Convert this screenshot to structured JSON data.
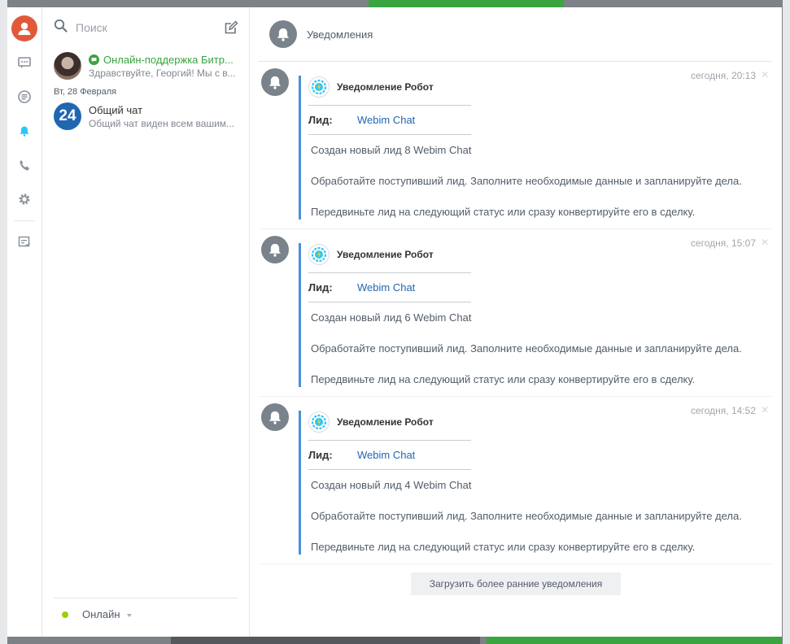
{
  "search": {
    "placeholder": "Поиск"
  },
  "chats": [
    {
      "title": "Онлайн-поддержка Битр...",
      "subtitle": "Здравствуйте, Георгий! Мы с в..."
    }
  ],
  "date_separator": "Вт, 28 Февраля",
  "chats_after_date": [
    {
      "avatar_text": "24",
      "title": "Общий чат",
      "subtitle": "Общий чат виден всем вашим..."
    }
  ],
  "status": {
    "label": "Онлайн"
  },
  "header": {
    "title": "Уведомления"
  },
  "notifications": [
    {
      "date": "сегодня, 20:13",
      "author": "Уведомление Робот",
      "field_label": "Лид:",
      "field_value": "Webim Chat",
      "line1": "Создан новый лид 8 Webim Chat",
      "line2": "Обработайте поступивший лид. Заполните необходимые данные и запланируйте дела.",
      "line3": "Передвиньте лид на следующий статус или сразу конвертируйте его в сделку."
    },
    {
      "date": "сегодня, 15:07",
      "author": "Уведомление Робот",
      "field_label": "Лид:",
      "field_value": "Webim Chat",
      "line1": "Создан новый лид 6 Webim Chat",
      "line2": "Обработайте поступивший лид. Заполните необходимые данные и запланируйте дела.",
      "line3": "Передвиньте лид на следующий статус или сразу конвертируйте его в сделку."
    },
    {
      "date": "сегодня, 14:52",
      "author": "Уведомление Робот",
      "field_label": "Лид:",
      "field_value": "Webim Chat",
      "line1": "Создан новый лид 4 Webim Chat",
      "line2": "Обработайте поступивший лид. Заполните необходимые данные и запланируйте дела.",
      "line3": "Передвиньте лид на следующий статус или сразу конвертируйте его в сделку."
    }
  ],
  "load_more_label": "Загрузить более ранние уведомления",
  "close_glyph": "✕",
  "icons": {
    "rail": [
      "user-avatar-icon",
      "chat-icon",
      "open-lines-icon",
      "bell-icon",
      "phone-icon",
      "gear-icon",
      "tasks-icon"
    ],
    "search": "search-icon",
    "compose": "compose-icon"
  },
  "colors": {
    "accent": "#2fc6f6",
    "online": "#9dcf00",
    "link": "#2067b0",
    "notif_border": "#4d8ee0",
    "avatar_user": "#e05a3a"
  }
}
